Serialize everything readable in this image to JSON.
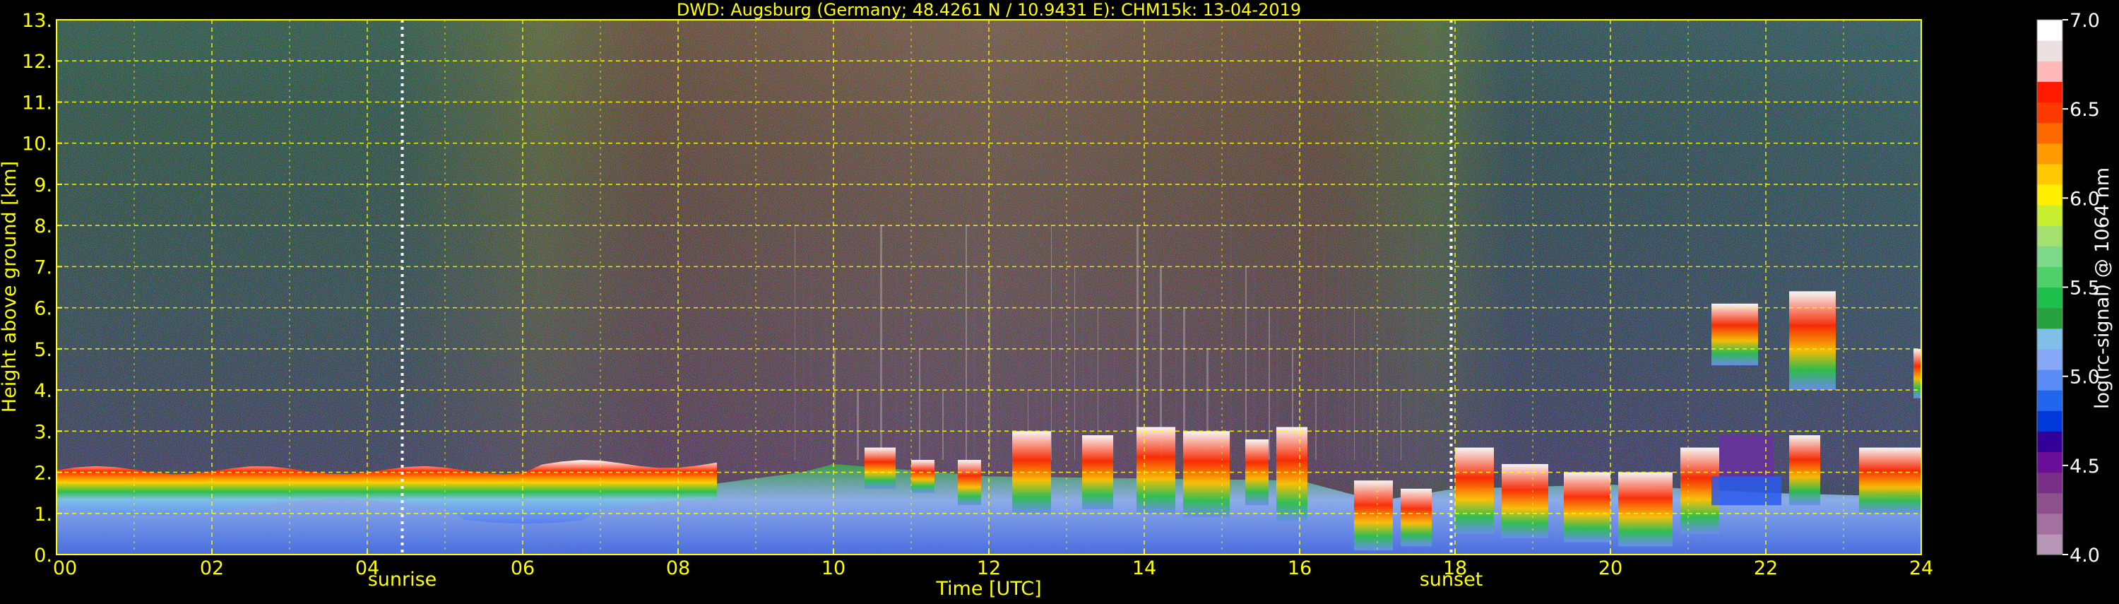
{
  "chart_data": {
    "type": "heatmap",
    "title": "DWD: Augsburg (Germany; 48.4261 N / 10.9431 E):    CHM15k: 13-04-2019",
    "xlabel": "Time [UTC]",
    "ylabel": "Height above ground [km]",
    "xlim": [
      0,
      24
    ],
    "ylim": [
      0,
      13
    ],
    "x_ticks": [
      0,
      2,
      4,
      6,
      8,
      10,
      12,
      14,
      16,
      18,
      20,
      22,
      24
    ],
    "x_tick_labels": [
      "00",
      "02",
      "04",
      "06",
      "08",
      "10",
      "12",
      "14",
      "16",
      "18",
      "20",
      "22",
      "24"
    ],
    "y_ticks": [
      0,
      1,
      2,
      3,
      4,
      5,
      6,
      7,
      8,
      9,
      10,
      11,
      12,
      13
    ],
    "y_tick_labels": [
      "0.",
      "1.",
      "2.",
      "3.",
      "4.",
      "5.",
      "6.",
      "7.",
      "8.",
      "9.",
      "10.",
      "11.",
      "12.",
      "13."
    ],
    "grid": true,
    "event_lines": [
      {
        "label": "sunrise",
        "time": 4.45
      },
      {
        "label": "sunset",
        "time": 17.95
      }
    ],
    "colorbar": {
      "label": "log(rc-signal) @ 1064 nm",
      "min": 4.0,
      "max": 7.0,
      "ticks": [
        "4.0",
        "4.5",
        "5.0",
        "5.5",
        "6.0",
        "6.5",
        "7.0"
      ],
      "colors": [
        "#b695b6",
        "#a3719f",
        "#8e4f8d",
        "#7a2f86",
        "#6a0e9a",
        "#330099",
        "#0038d9",
        "#2166ee",
        "#5a8cf5",
        "#86a8f7",
        "#7fbfe8",
        "#27a040",
        "#1fbf4c",
        "#4fd06b",
        "#7dd98a",
        "#a4e070",
        "#c8ee30",
        "#fff000",
        "#ffc800",
        "#ff9a00",
        "#ff6a00",
        "#ff3a00",
        "#ff1a00",
        "#ffb8b8",
        "#ece0e0",
        "#ffffff"
      ]
    },
    "colors": {
      "text": "#ffff00",
      "grid": "#ffff00",
      "background": "#000000",
      "colorbar_text": "#ffffff"
    }
  }
}
